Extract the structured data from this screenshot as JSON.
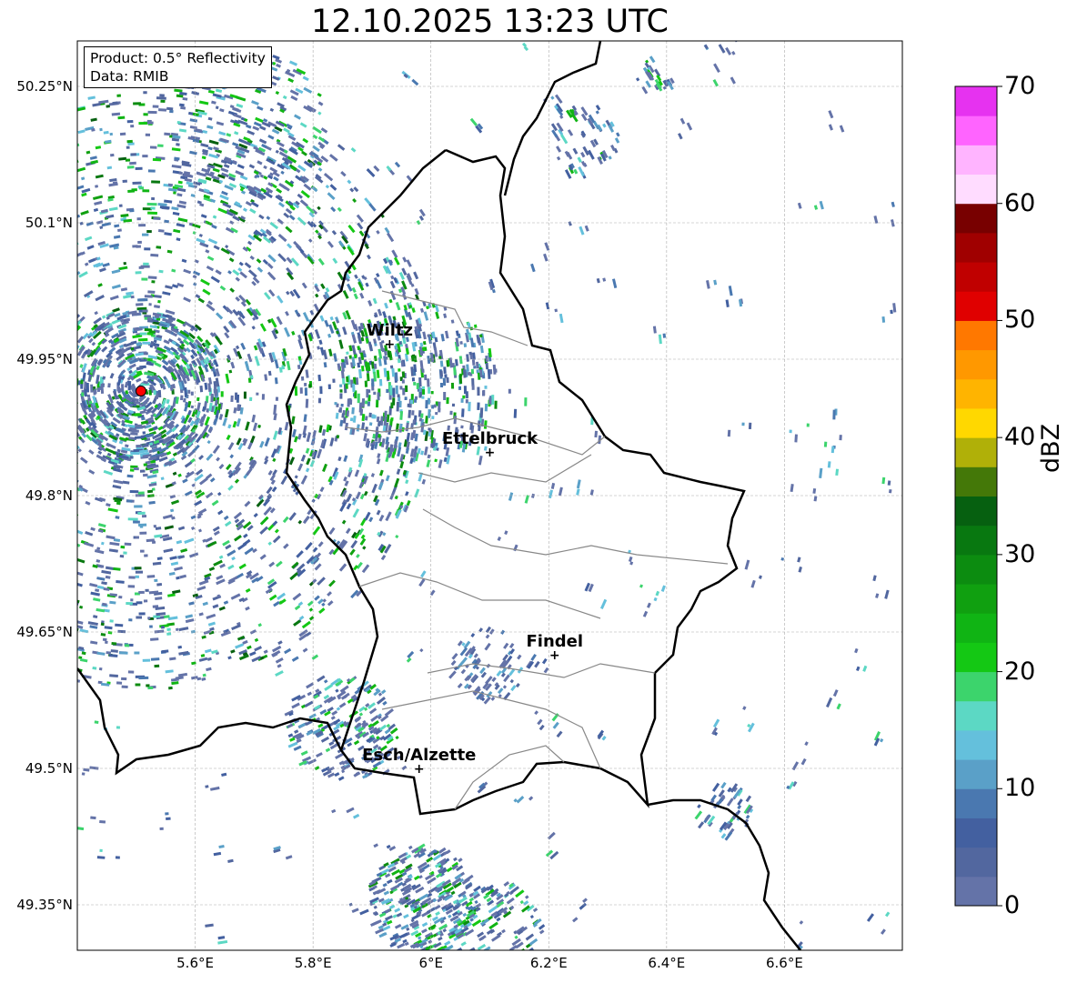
{
  "title": "12.10.2025 13:23 UTC",
  "info": {
    "product": "Product: 0.5° Reflectivity",
    "data": "Data: RMIB"
  },
  "map": {
    "lon_range": [
      5.4,
      6.8
    ],
    "lat_range": [
      49.3,
      50.3
    ],
    "lon_ticks": [
      "5.6°E",
      "5.8°E",
      "6°E",
      "6.2°E",
      "6.4°E",
      "6.6°E"
    ],
    "lat_ticks": [
      "50.25°N",
      "50.1°N",
      "49.95°N",
      "49.8°N",
      "49.65°N",
      "49.5°N",
      "49.35°N"
    ],
    "grid": true,
    "cities": [
      {
        "name": "Wiltz",
        "lon": 5.93,
        "lat": 49.967
      },
      {
        "name": "Ettelbruck",
        "lon": 6.1,
        "lat": 49.848
      },
      {
        "name": "Findel",
        "lon": 6.21,
        "lat": 49.625
      },
      {
        "name": "Esch/Alzette",
        "lon": 5.98,
        "lat": 49.5
      }
    ],
    "radar_site": {
      "lon": 5.508,
      "lat": 49.915,
      "color": "#ff0000"
    }
  },
  "colorbar": {
    "label": "dBZ",
    "min": 0,
    "max": 70,
    "step": 2.5,
    "ticks": [
      "0",
      "10",
      "20",
      "30",
      "40",
      "50",
      "60",
      "70"
    ],
    "colors": [
      "#6473a8",
      "#52679f",
      "#4360a0",
      "#4a78b0",
      "#5aa0c8",
      "#64c0dc",
      "#5cd8c4",
      "#3cd46c",
      "#14c814",
      "#10b414",
      "#10a010",
      "#0c8c10",
      "#087810",
      "#066010",
      "#447808",
      "#b0b008",
      "#ffd800",
      "#ffb400",
      "#ff9800",
      "#ff7800",
      "#e00000",
      "#c00000",
      "#a00000",
      "#780000",
      "#ffdcff",
      "#ffb4ff",
      "#ff64ff",
      "#e632f0"
    ]
  }
}
